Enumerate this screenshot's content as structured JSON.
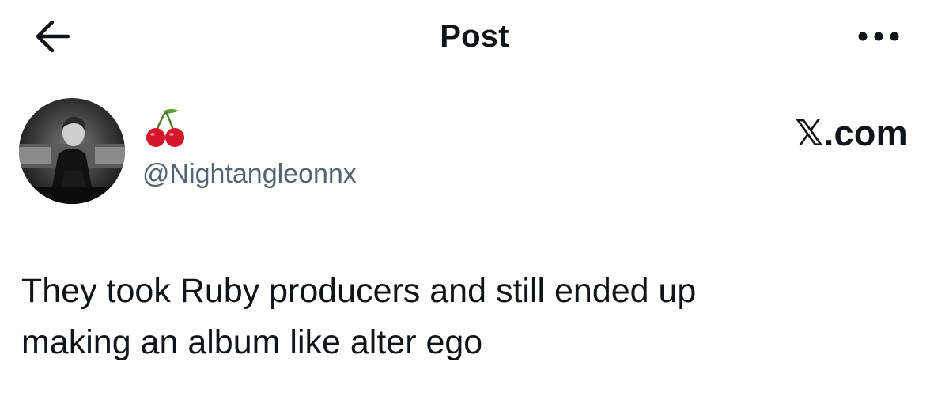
{
  "header": {
    "title": "Post",
    "back_icon": "arrow-left-icon",
    "more_icon": "more-horizontal-icon"
  },
  "author": {
    "display_name_icon": "cherries-emoji",
    "handle": "@Nightangleonnx",
    "avatar": "profile-photo"
  },
  "watermark": "𝕏.com",
  "post": {
    "text_lines": [
      "They took Ruby producers and still ended up",
      "making an album like alter ego"
    ]
  },
  "colors": {
    "text_primary": "#0f1419",
    "text_secondary": "#536471",
    "background": "#ffffff",
    "cherry_red": "#d3162b",
    "leaf_green": "#5e9b35"
  }
}
